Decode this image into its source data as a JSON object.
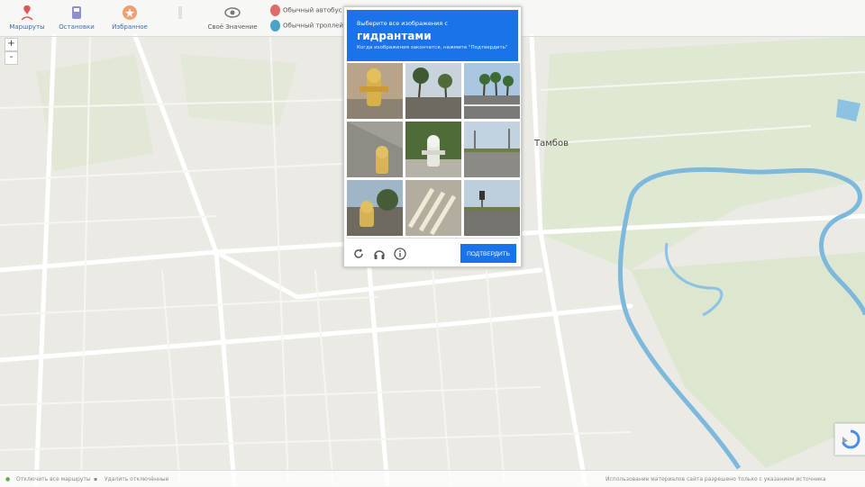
{
  "toolbar": {
    "items": [
      {
        "label": "Маршруты",
        "icon": "route-icon"
      },
      {
        "label": "Остановки",
        "icon": "bus-stop-icon"
      },
      {
        "label": "Избранное",
        "icon": "favorite-icon"
      },
      {
        "label": "",
        "icon": "faded-icon"
      },
      {
        "label": "Своё Значение",
        "icon": "eye-icon"
      }
    ],
    "side_items": [
      {
        "label": "Обычный автобус",
        "color": "#e06b6b"
      },
      {
        "label": "Обычный троллейбус",
        "color": "#4aa3c7"
      }
    ]
  },
  "map": {
    "zoom_in": "+",
    "zoom_out": "-",
    "city_label": "Тамбов"
  },
  "captcha": {
    "instruction": "Выберите все изображения с",
    "target": "гидрантами",
    "hint": "Когда изображения закончатся, нажмите \"Подтвердить\"",
    "verify_label": "ПОДТВЕРДИТЬ",
    "tiles": [
      {
        "name": "hydrant-1"
      },
      {
        "name": "palm-street"
      },
      {
        "name": "palm-road"
      },
      {
        "name": "hydrant-2"
      },
      {
        "name": "hydrant-3"
      },
      {
        "name": "road-poles"
      },
      {
        "name": "hydrant-4"
      },
      {
        "name": "crosswalk"
      },
      {
        "name": "traffic-light"
      }
    ],
    "colors": {
      "accent": "#1a73e8"
    }
  },
  "statusbar": {
    "left": "Отключить все маршруты",
    "mid": "Удалить отключённые",
    "right": "Использование материалов сайта разрешено только с указанием источника"
  }
}
